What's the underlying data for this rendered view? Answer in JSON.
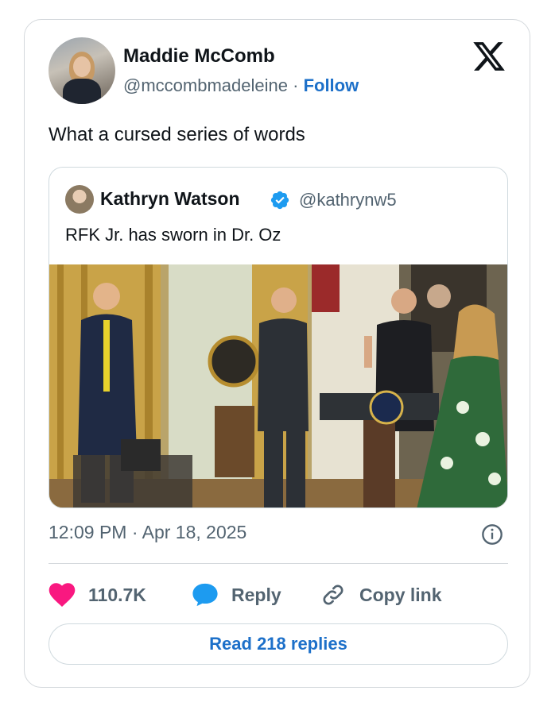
{
  "author": {
    "name": "Maddie McComb",
    "handle": "@mccombmadeleine",
    "separator": "·",
    "follow_label": "Follow"
  },
  "tweet": {
    "text": "What a cursed series of words",
    "timestamp": "12:09 PM · Apr 18, 2025"
  },
  "quoted": {
    "name": "Kathryn Watson",
    "handle": "@kathrynw5",
    "text": "RFK Jr. has sworn in Dr. Oz"
  },
  "actions": {
    "likes": "110.7K",
    "reply_label": "Reply",
    "copy_label": "Copy link",
    "read_replies_label": "Read 218 replies"
  },
  "colors": {
    "accent": "#1d70c9",
    "like": "#f91880",
    "reply_bubble": "#1d9bf0",
    "verified": "#1d9bf0"
  },
  "icons": [
    "x-logo-icon",
    "verified-badge-icon",
    "info-icon",
    "heart-icon",
    "reply-bubble-icon",
    "link-icon"
  ]
}
